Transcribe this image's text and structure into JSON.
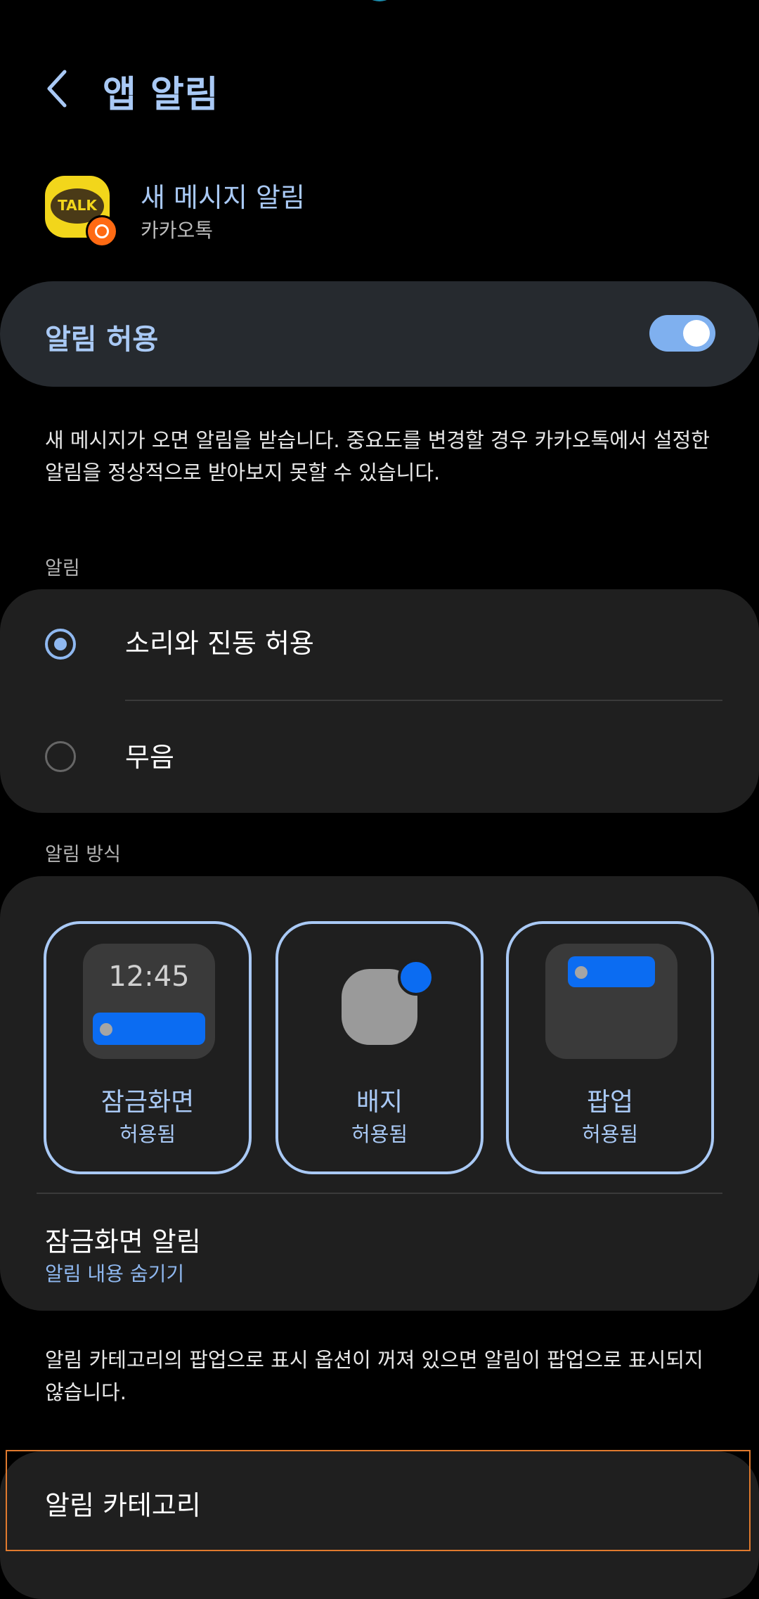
{
  "header": {
    "title": "앱 알림",
    "back_icon": "back-chevron-icon"
  },
  "app_info": {
    "icon_text": "TALK",
    "channel_name": "새 메시지 알림",
    "app_name": "카카오톡"
  },
  "allow": {
    "label": "알림 허용",
    "enabled": true
  },
  "allow_description": "새 메시지가 오면 알림을 받습니다. 중요도를 변경할 경우 카카오톡에서 설정한 알림을 정상적으로 받아보지 못할 수 있습니다.",
  "alert_section": {
    "label": "알림",
    "options": [
      {
        "label": "소리와 진동 허용",
        "selected": true
      },
      {
        "label": "무음",
        "selected": false
      }
    ]
  },
  "method_section": {
    "label": "알림 방식",
    "tiles": [
      {
        "title": "잠금화면",
        "status": "허용됨",
        "preview_time": "12:45"
      },
      {
        "title": "배지",
        "status": "허용됨"
      },
      {
        "title": "팝업",
        "status": "허용됨"
      }
    ],
    "lockscreen": {
      "title": "잠금화면 알림",
      "value": "알림 내용 숨기기"
    }
  },
  "popup_description": "알림 카테고리의 팝업으로 표시 옵션이 꺼져 있으면 알림이 팝업으로 표시되지 않습니다.",
  "category": {
    "label": "알림 카테고리"
  },
  "colors": {
    "accent": "#a9c9f5",
    "toggle_on": "#7fb0ef",
    "card": "#1f1f1f",
    "highlight": "#e07a2e"
  }
}
